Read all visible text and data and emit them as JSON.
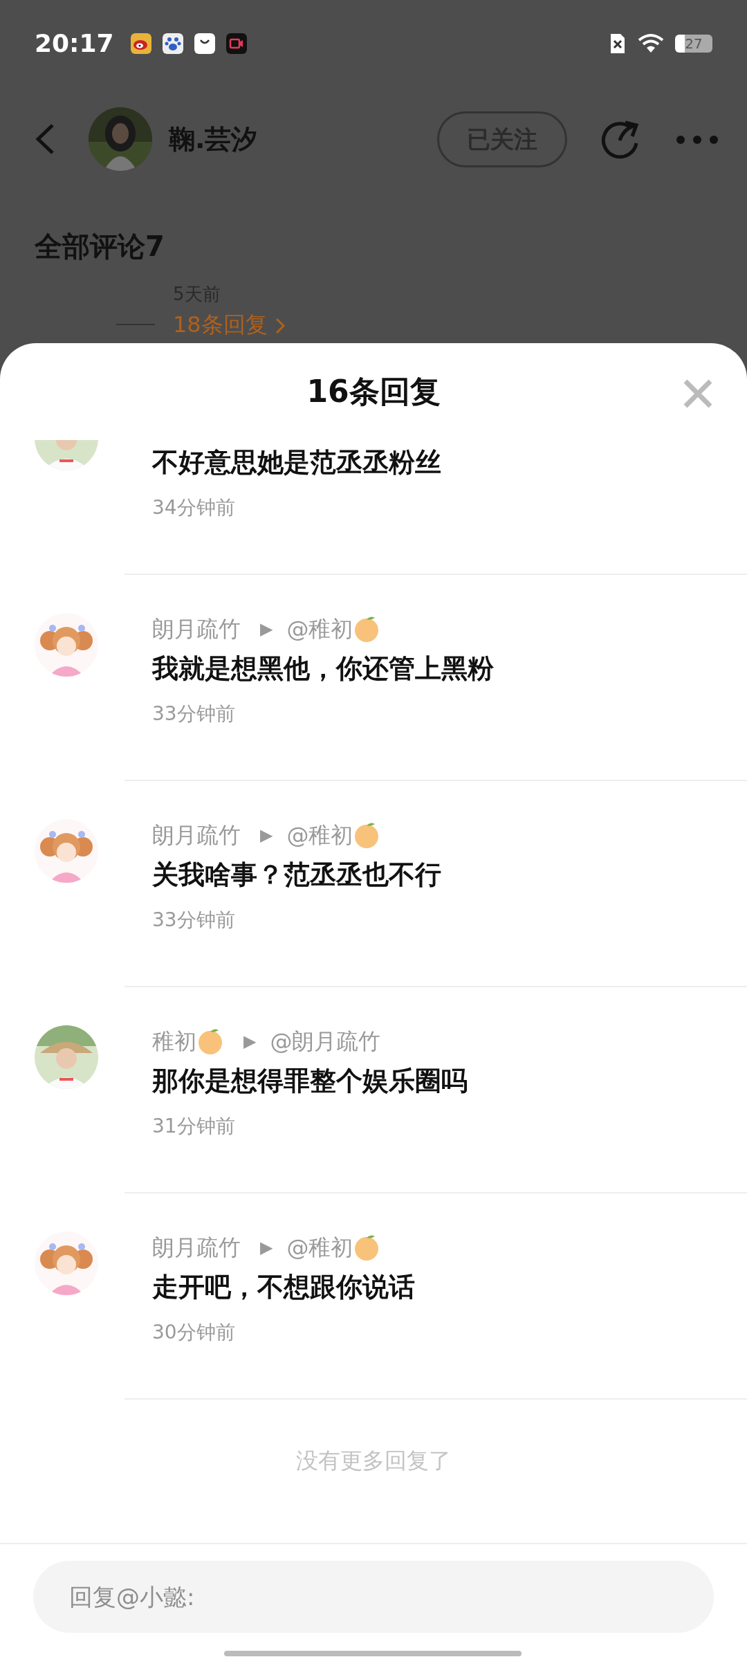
{
  "status_bar": {
    "time": "20:17",
    "battery": "27"
  },
  "header": {
    "username": "鞠.芸汐",
    "follow_button": "已关注"
  },
  "comments_section": {
    "title": "全部评论7",
    "partial_time": "5天前",
    "replies_link": "18条回复"
  },
  "reply_sheet": {
    "title": "16条回复",
    "replies": [
      {
        "message": "不好意思她是范丞丞粉丝",
        "time": "34分钟前"
      },
      {
        "kind": "illustration",
        "author": "朗月疏竹",
        "author_orange": false,
        "arrow": "▶",
        "target": "@稚初",
        "target_orange": true,
        "message": "我就是想黑他，你还管上黑粉",
        "time": "33分钟前"
      },
      {
        "kind": "illustration",
        "author": "朗月疏竹",
        "author_orange": false,
        "arrow": "▶",
        "target": "@稚初",
        "target_orange": true,
        "message": "关我啥事？范丞丞也不行",
        "time": "33分钟前"
      },
      {
        "author": "稚初",
        "author_orange": true,
        "arrow": "▶",
        "target": "@朗月疏竹",
        "target_orange": false,
        "message": "那你是想得罪整个娱乐圈吗",
        "time": "31分钟前"
      },
      {
        "kind": "illustration",
        "author": "朗月疏竹",
        "author_orange": false,
        "arrow": "▶",
        "target": "@稚初",
        "target_orange": true,
        "message": "走开吧，不想跟你说话",
        "time": "30分钟前"
      }
    ],
    "end_text": "没有更多回复了",
    "reply_input": {
      "placeholder": "回复@小懿:"
    }
  }
}
